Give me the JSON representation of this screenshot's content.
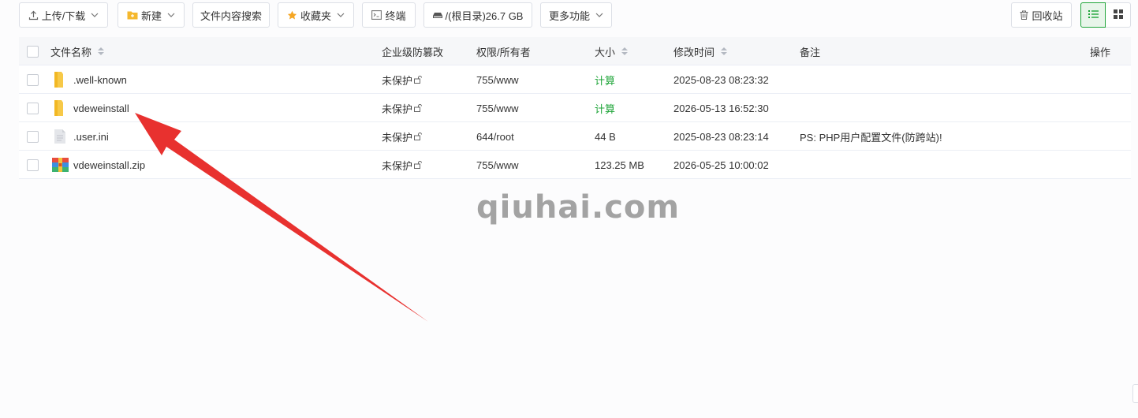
{
  "toolbar": {
    "upload_download": "上传/下载",
    "new": "新建",
    "content_search": "文件内容搜索",
    "favorites": "收藏夹",
    "terminal": "终端",
    "disk": "/(根目录)26.7 GB",
    "more": "更多功能",
    "recycle": "回收站"
  },
  "table": {
    "headers": {
      "name": "文件名称",
      "tamper": "企业级防篡改",
      "perm": "权限/所有者",
      "size": "大小",
      "mtime": "修改时间",
      "note": "备注",
      "actions": "操作"
    },
    "rows": [
      {
        "name": ".well-known",
        "type": "folder",
        "tamper": "未保护",
        "perm": "755/www",
        "size": "计算",
        "mtime": "2025-08-23 08:23:32",
        "note": ""
      },
      {
        "name": "vdeweinstall",
        "type": "folder",
        "tamper": "未保护",
        "perm": "755/www",
        "size": "计算",
        "mtime": "2026-05-13 16:52:30",
        "note": ""
      },
      {
        "name": ".user.ini",
        "type": "file",
        "tamper": "未保护",
        "perm": "644/root",
        "size": "44 B",
        "mtime": "2025-08-23 08:23:14",
        "note": "PS: PHP用户配置文件(防跨站)!"
      },
      {
        "name": "vdeweinstall.zip",
        "type": "zip",
        "tamper": "未保护",
        "perm": "755/www",
        "size": "123.25 MB",
        "mtime": "2026-05-25 10:00:02",
        "note": ""
      }
    ]
  },
  "watermark": "qiuhai.com",
  "colors": {
    "accent": "#20a53a",
    "arrow": "#e8312f",
    "folder": "#f7c948"
  }
}
